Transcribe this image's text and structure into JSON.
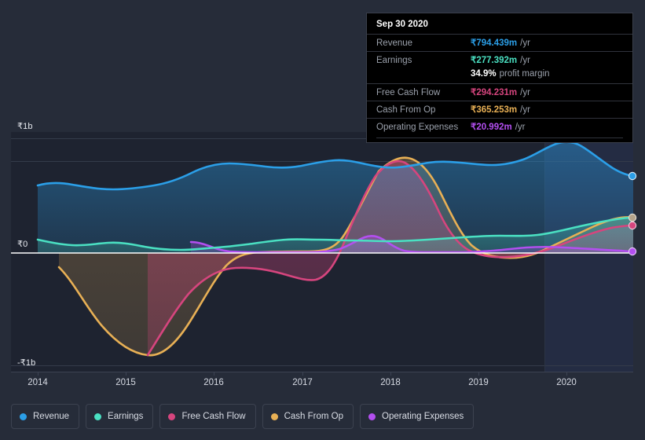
{
  "colors": {
    "background": "#262c39",
    "plot_background": "#1e2330",
    "forecast_background": "#232a3c",
    "grid": "#333a49",
    "zero_line": "#ffffff",
    "revenue": "#2b9fe8",
    "earnings": "#4ae0c2",
    "free_cash_flow": "#d6457e",
    "cash_from_op": "#e8b055",
    "operating_expenses": "#b34ff0",
    "tooltip_bg": "#000000",
    "tooltip_border": "#3a3f4b",
    "tooltip_label": "#9aa0ab",
    "axis_text": "#e6e9ef"
  },
  "tooltip": {
    "title": "Sep 30 2020",
    "rows": [
      {
        "label": "Revenue",
        "value": "₹794.439m",
        "unit": "/yr",
        "color": "#2b9fe8"
      },
      {
        "label": "Earnings",
        "value": "₹277.392m",
        "unit": "/yr",
        "color": "#4ae0c2"
      },
      {
        "label": "",
        "value": "34.9%",
        "unit": "profit margin",
        "color": "#ffffff"
      },
      {
        "label": "Free Cash Flow",
        "value": "₹294.231m",
        "unit": "/yr",
        "color": "#d6457e"
      },
      {
        "label": "Cash From Op",
        "value": "₹365.253m",
        "unit": "/yr",
        "color": "#e8b055"
      },
      {
        "label": "Operating Expenses",
        "value": "₹20.992m",
        "unit": "/yr",
        "color": "#b34ff0"
      }
    ]
  },
  "legend": {
    "items": [
      {
        "label": "Revenue",
        "color": "#2b9fe8"
      },
      {
        "label": "Earnings",
        "color": "#4ae0c2"
      },
      {
        "label": "Free Cash Flow",
        "color": "#d6457e"
      },
      {
        "label": "Cash From Op",
        "color": "#e8b055"
      },
      {
        "label": "Operating Expenses",
        "color": "#b34ff0"
      }
    ]
  },
  "axes": {
    "y_labels": [
      "₹1b",
      "₹0",
      "-₹1b"
    ],
    "x_labels": [
      "2014",
      "2015",
      "2016",
      "2017",
      "2018",
      "2019",
      "2020"
    ]
  },
  "chart_data": {
    "type": "area",
    "title": "",
    "xlabel": "",
    "ylabel": "",
    "ylim": [
      -1000000000,
      1000000000
    ],
    "y_tick_labels": [
      "₹1b",
      "₹0",
      "-₹1b"
    ],
    "y_tick_values": [
      1000000000,
      0,
      -1000000000
    ],
    "x_tick_labels": [
      "2014",
      "2015",
      "2016",
      "2017",
      "2018",
      "2019",
      "2020"
    ],
    "grid": true,
    "legend_position": "bottom",
    "currency": "INR",
    "value_unit": "per year",
    "highlight_date": "Sep 30 2020",
    "series": [
      {
        "name": "Revenue",
        "color": "#2b9fe8",
        "x": [
          2013.95,
          2014.25,
          2014.6,
          2015.0,
          2015.4,
          2015.8,
          2016.1,
          2016.5,
          2016.9,
          2017.3,
          2017.7,
          2018.0,
          2018.3,
          2018.6,
          2019.0,
          2019.4,
          2019.75,
          2020.1,
          2020.45,
          2020.75
        ],
        "values": [
          580000000,
          560000000,
          545000000,
          548000000,
          560000000,
          620000000,
          640000000,
          648000000,
          660000000,
          672000000,
          690000000,
          700000000,
          702000000,
          712000000,
          716000000,
          760000000,
          880000000,
          900000000,
          840000000,
          794439000
        ]
      },
      {
        "name": "Earnings",
        "color": "#4ae0c2",
        "x": [
          2013.95,
          2014.3,
          2014.7,
          2015.0,
          2015.4,
          2015.8,
          2016.2,
          2016.6,
          2017.0,
          2017.4,
          2017.8,
          2018.2,
          2018.6,
          2019.0,
          2019.4,
          2019.8,
          2020.2,
          2020.75
        ],
        "values": [
          90000000,
          65000000,
          70000000,
          55000000,
          40000000,
          42000000,
          48000000,
          55000000,
          80000000,
          80000000,
          78000000,
          82000000,
          95000000,
          105000000,
          90000000,
          120000000,
          200000000,
          277392000
        ]
      },
      {
        "name": "Free Cash Flow",
        "color": "#d6457e",
        "x": [
          2015.22,
          2015.5,
          2015.9,
          2016.3,
          2016.7,
          2017.0,
          2017.3,
          2017.6,
          2017.9,
          2018.15,
          2018.45,
          2018.8,
          2019.1,
          2019.5,
          2019.9,
          2020.3,
          2020.75
        ],
        "values": [
          -980000000,
          -620000000,
          -230000000,
          -150000000,
          -190000000,
          -220000000,
          -180000000,
          20000000,
          520000000,
          790000000,
          560000000,
          40000000,
          -20000000,
          -10000000,
          60000000,
          190000000,
          294231000
        ]
      },
      {
        "name": "Cash From Op",
        "color": "#e8b055",
        "x": [
          2014.15,
          2014.5,
          2014.9,
          2015.3,
          2015.7,
          2016.0,
          2016.3,
          2016.7,
          2017.1,
          2017.5,
          2017.8,
          2018.1,
          2018.4,
          2018.75,
          2019.1,
          2019.5,
          2019.9,
          2020.3,
          2020.75
        ],
        "values": [
          -120000000,
          -340000000,
          -560000000,
          -660000000,
          -640000000,
          -300000000,
          -140000000,
          -105000000,
          -100000000,
          -60000000,
          320000000,
          800000000,
          700000000,
          200000000,
          60000000,
          50000000,
          110000000,
          250000000,
          365253000
        ]
      },
      {
        "name": "Operating Expenses",
        "color": "#b34ff0",
        "x": [
          2015.45,
          2015.8,
          2016.2,
          2016.6,
          2017.0,
          2017.4,
          2017.65,
          2017.9,
          2018.2,
          2018.5,
          2018.8,
          2019.2,
          2019.6,
          2020.0,
          2020.4,
          2020.75
        ],
        "values": [
          -6000000,
          -45000000,
          -48000000,
          -48000000,
          -48000000,
          -20000000,
          55000000,
          10000000,
          -5000000,
          22000000,
          -8000000,
          -12000000,
          -10000000,
          -14000000,
          -18000000,
          -20992000
        ]
      }
    ]
  }
}
